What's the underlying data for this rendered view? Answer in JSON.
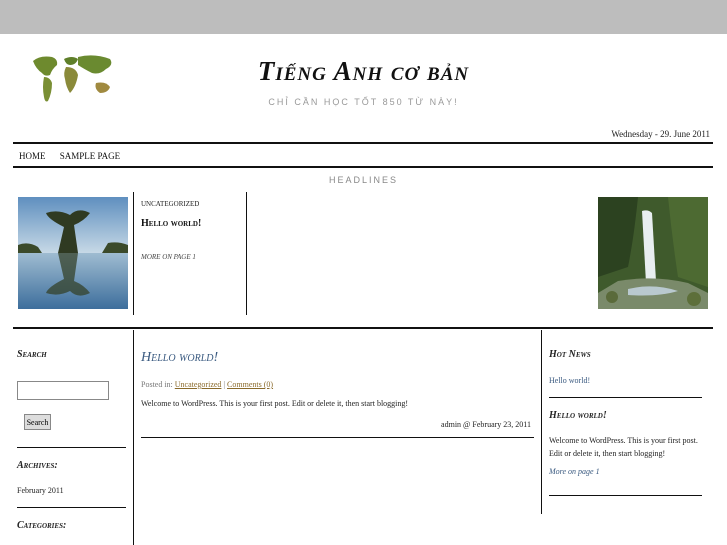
{
  "site": {
    "title": "Tiếng Anh cơ bản",
    "tagline": "CHỈ CẦN HỌC TỐT 850 TỪ NÀY!",
    "date": "Wednesday - 29. June 2011"
  },
  "nav": {
    "items": [
      "HOME",
      "SAMPLE PAGE"
    ]
  },
  "headlines": {
    "label": "HEADLINES",
    "category": "UNCATEGORIZED",
    "title": "Hello world!",
    "more": "MORE ON PAGE 1"
  },
  "left_sidebar": {
    "search_heading": "Search",
    "search_value": "",
    "search_button": "Search",
    "archives_heading": "Archives:",
    "archive_item": "February 2011",
    "categories_heading": "Categories:"
  },
  "post": {
    "title": "Hello world!",
    "posted_in": "Posted in:",
    "category": "Uncategorized",
    "separator": "|",
    "comments": "Comments (0)",
    "body": "Welcome to WordPress. This is your first post. Edit or delete it, then start blogging!",
    "byline": "admin @ February 23, 2011"
  },
  "right_sidebar": {
    "hot_news_heading": "Hot News",
    "hot_news_item": "Hello world!",
    "widget_heading": "Hello world!",
    "widget_body": "Welcome to WordPress. This is your first post. Edit or delete it, then start blogging!",
    "widget_more": "More on page 1"
  }
}
